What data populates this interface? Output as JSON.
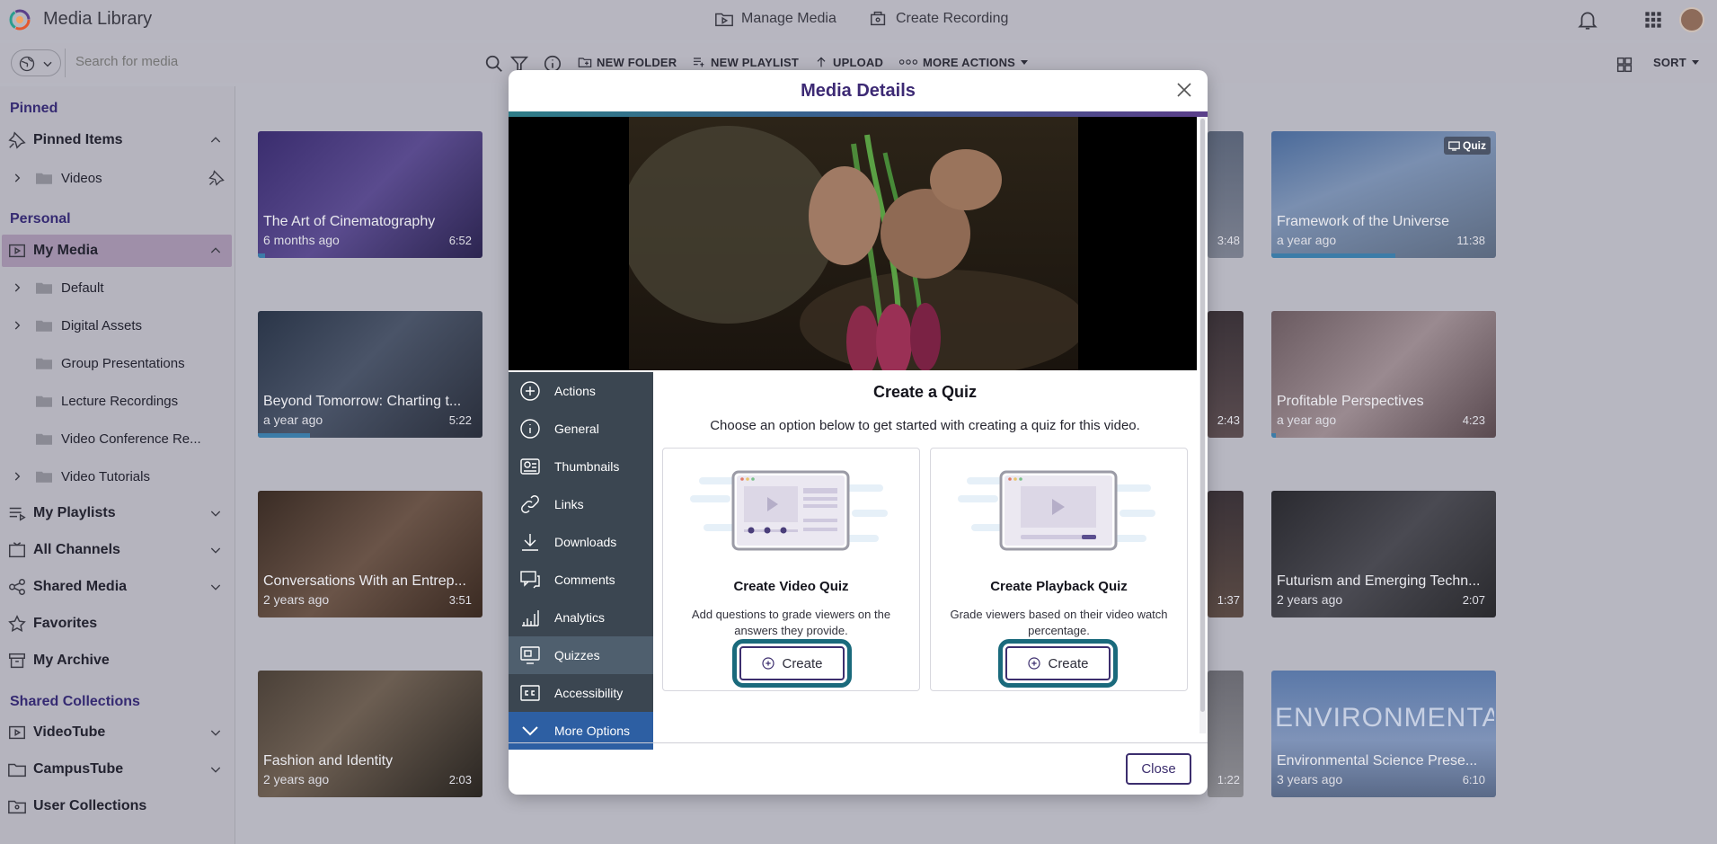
{
  "app": {
    "title": "Media Library"
  },
  "topnav": {
    "manage_media": "Manage Media",
    "create_recording": "Create Recording"
  },
  "toolbar": {
    "search_placeholder": "Search for media",
    "new_folder": "NEW FOLDER",
    "new_playlist": "NEW PLAYLIST",
    "upload": "UPLOAD",
    "more_actions": "MORE ACTIONS",
    "sort": "SORT"
  },
  "sidebar": {
    "pinned_header": "Pinned",
    "pinned_items": "Pinned Items",
    "videos": "Videos",
    "personal_header": "Personal",
    "my_media": "My Media",
    "folders": [
      "Default",
      "Digital Assets",
      "Group Presentations",
      "Lecture Recordings",
      "Video Conference Re...",
      "Video Tutorials"
    ],
    "my_playlists": "My Playlists",
    "all_channels": "All Channels",
    "shared_media": "Shared Media",
    "favorites": "Favorites",
    "my_archive": "My Archive",
    "shared_collections_header": "Shared Collections",
    "videotube": "VideoTube",
    "campustube": "CampusTube",
    "user_collections": "User Collections"
  },
  "cards": [
    {
      "title": "The Art of Cinematography",
      "date": "6 months ago",
      "duration": "6:52",
      "progress": 0.03
    },
    {
      "title": "Beyond Tomorrow: Charting t...",
      "date": "a year ago",
      "duration": "5:22",
      "progress": 0.23
    },
    {
      "title": "Conversations With an Entrep...",
      "date": "2 years ago",
      "duration": "3:51",
      "progress": 0
    },
    {
      "title": "Fashion and Identity",
      "date": "2 years ago",
      "duration": "2:03",
      "progress": 0
    },
    {
      "title": "Framework of the Universe",
      "date": "a year ago",
      "duration": "11:38",
      "progress": 0.55,
      "badge": "Quiz"
    },
    {
      "title": "Profitable Perspectives",
      "date": "a year ago",
      "duration": "4:23",
      "progress": 0.02
    },
    {
      "title": "Futurism and Emerging Techn...",
      "date": "2 years ago",
      "duration": "2:07",
      "progress": 0
    },
    {
      "title": "Environmental Science Prese...",
      "date": "3 years ago",
      "duration": "6:10",
      "progress": 0,
      "overlay": "ENVIRONMENTAL SCIENCE"
    }
  ],
  "partial_durations": [
    "3:48",
    "2:43",
    "1:37",
    "1:22"
  ],
  "modal": {
    "title": "Media Details",
    "nav": [
      "Actions",
      "General",
      "Thumbnails",
      "Links",
      "Downloads",
      "Comments",
      "Analytics",
      "Quizzes",
      "Accessibility",
      "More Options"
    ],
    "active_nav": "Quizzes",
    "quiz": {
      "title": "Create a Quiz",
      "subtitle": "Choose an option below to get started with creating a quiz for this video.",
      "video_quiz": {
        "title": "Create Video Quiz",
        "desc": "Add questions to grade viewers on the answers they provide.",
        "button": "Create"
      },
      "playback_quiz": {
        "title": "Create Playback Quiz",
        "desc": "Grade viewers based on their video watch percentage.",
        "button": "Create"
      }
    },
    "close_label": "Close"
  },
  "colors": {
    "accent": "#3d2a74",
    "nav_bg": "#3b4651",
    "highlight_ring": "#1a6a7c",
    "progress": "#3c7ca8"
  }
}
